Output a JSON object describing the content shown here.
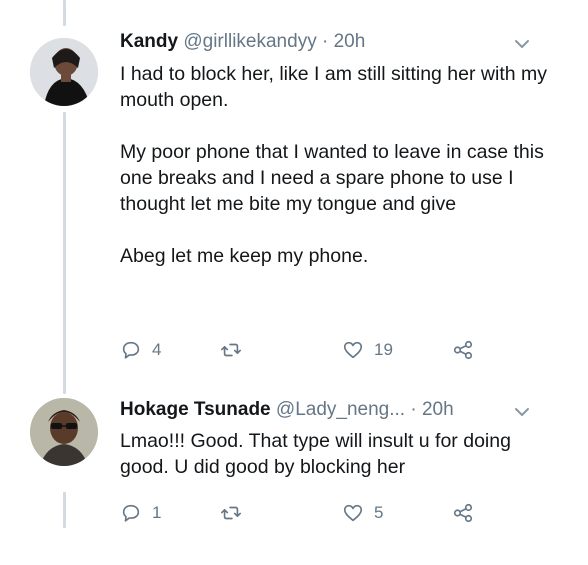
{
  "tweets": [
    {
      "name": "Kandy",
      "handle": "@girllikekandyy",
      "separator": "·",
      "time": "20h",
      "paragraphs": [
        "I had to block her, like I am still sitting her with my mouth open.",
        "My poor phone that I wanted to leave in case this one breaks and I need a spare phone to use I thought let me bite my tongue and give",
        "Abeg let me keep my phone."
      ],
      "replies": "4",
      "likes": "19",
      "icons": [
        "reply-icon",
        "retweet-icon",
        "heart-icon",
        "share-icon",
        "chevron-down-icon"
      ]
    },
    {
      "name": "Hokage Tsunade",
      "handle": "@Lady_neng...",
      "separator": "·",
      "time": "20h",
      "paragraphs": [
        "Lmao!!! Good. That type will insult u for doing good. U did good by blocking her"
      ],
      "replies": "1",
      "likes": "5",
      "icons": [
        "reply-icon",
        "retweet-icon",
        "heart-icon",
        "share-icon",
        "chevron-down-icon"
      ]
    }
  ],
  "colors": {
    "text": "#14171a",
    "secondary": "#657786",
    "thread_line": "#d3dbe2",
    "background": "#ffffff"
  }
}
